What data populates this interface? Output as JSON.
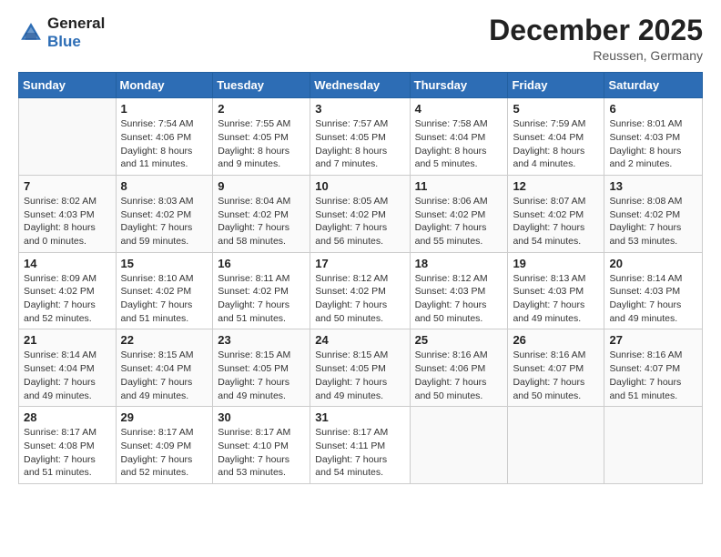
{
  "header": {
    "logo_line1": "General",
    "logo_line2": "Blue",
    "month": "December 2025",
    "location": "Reussen, Germany"
  },
  "weekdays": [
    "Sunday",
    "Monday",
    "Tuesday",
    "Wednesday",
    "Thursday",
    "Friday",
    "Saturday"
  ],
  "weeks": [
    [
      {
        "day": "",
        "sunrise": "",
        "sunset": "",
        "daylight": ""
      },
      {
        "day": "1",
        "sunrise": "Sunrise: 7:54 AM",
        "sunset": "Sunset: 4:06 PM",
        "daylight": "Daylight: 8 hours and 11 minutes."
      },
      {
        "day": "2",
        "sunrise": "Sunrise: 7:55 AM",
        "sunset": "Sunset: 4:05 PM",
        "daylight": "Daylight: 8 hours and 9 minutes."
      },
      {
        "day": "3",
        "sunrise": "Sunrise: 7:57 AM",
        "sunset": "Sunset: 4:05 PM",
        "daylight": "Daylight: 8 hours and 7 minutes."
      },
      {
        "day": "4",
        "sunrise": "Sunrise: 7:58 AM",
        "sunset": "Sunset: 4:04 PM",
        "daylight": "Daylight: 8 hours and 5 minutes."
      },
      {
        "day": "5",
        "sunrise": "Sunrise: 7:59 AM",
        "sunset": "Sunset: 4:04 PM",
        "daylight": "Daylight: 8 hours and 4 minutes."
      },
      {
        "day": "6",
        "sunrise": "Sunrise: 8:01 AM",
        "sunset": "Sunset: 4:03 PM",
        "daylight": "Daylight: 8 hours and 2 minutes."
      }
    ],
    [
      {
        "day": "7",
        "sunrise": "Sunrise: 8:02 AM",
        "sunset": "Sunset: 4:03 PM",
        "daylight": "Daylight: 8 hours and 0 minutes."
      },
      {
        "day": "8",
        "sunrise": "Sunrise: 8:03 AM",
        "sunset": "Sunset: 4:02 PM",
        "daylight": "Daylight: 7 hours and 59 minutes."
      },
      {
        "day": "9",
        "sunrise": "Sunrise: 8:04 AM",
        "sunset": "Sunset: 4:02 PM",
        "daylight": "Daylight: 7 hours and 58 minutes."
      },
      {
        "day": "10",
        "sunrise": "Sunrise: 8:05 AM",
        "sunset": "Sunset: 4:02 PM",
        "daylight": "Daylight: 7 hours and 56 minutes."
      },
      {
        "day": "11",
        "sunrise": "Sunrise: 8:06 AM",
        "sunset": "Sunset: 4:02 PM",
        "daylight": "Daylight: 7 hours and 55 minutes."
      },
      {
        "day": "12",
        "sunrise": "Sunrise: 8:07 AM",
        "sunset": "Sunset: 4:02 PM",
        "daylight": "Daylight: 7 hours and 54 minutes."
      },
      {
        "day": "13",
        "sunrise": "Sunrise: 8:08 AM",
        "sunset": "Sunset: 4:02 PM",
        "daylight": "Daylight: 7 hours and 53 minutes."
      }
    ],
    [
      {
        "day": "14",
        "sunrise": "Sunrise: 8:09 AM",
        "sunset": "Sunset: 4:02 PM",
        "daylight": "Daylight: 7 hours and 52 minutes."
      },
      {
        "day": "15",
        "sunrise": "Sunrise: 8:10 AM",
        "sunset": "Sunset: 4:02 PM",
        "daylight": "Daylight: 7 hours and 51 minutes."
      },
      {
        "day": "16",
        "sunrise": "Sunrise: 8:11 AM",
        "sunset": "Sunset: 4:02 PM",
        "daylight": "Daylight: 7 hours and 51 minutes."
      },
      {
        "day": "17",
        "sunrise": "Sunrise: 8:12 AM",
        "sunset": "Sunset: 4:02 PM",
        "daylight": "Daylight: 7 hours and 50 minutes."
      },
      {
        "day": "18",
        "sunrise": "Sunrise: 8:12 AM",
        "sunset": "Sunset: 4:03 PM",
        "daylight": "Daylight: 7 hours and 50 minutes."
      },
      {
        "day": "19",
        "sunrise": "Sunrise: 8:13 AM",
        "sunset": "Sunset: 4:03 PM",
        "daylight": "Daylight: 7 hours and 49 minutes."
      },
      {
        "day": "20",
        "sunrise": "Sunrise: 8:14 AM",
        "sunset": "Sunset: 4:03 PM",
        "daylight": "Daylight: 7 hours and 49 minutes."
      }
    ],
    [
      {
        "day": "21",
        "sunrise": "Sunrise: 8:14 AM",
        "sunset": "Sunset: 4:04 PM",
        "daylight": "Daylight: 7 hours and 49 minutes."
      },
      {
        "day": "22",
        "sunrise": "Sunrise: 8:15 AM",
        "sunset": "Sunset: 4:04 PM",
        "daylight": "Daylight: 7 hours and 49 minutes."
      },
      {
        "day": "23",
        "sunrise": "Sunrise: 8:15 AM",
        "sunset": "Sunset: 4:05 PM",
        "daylight": "Daylight: 7 hours and 49 minutes."
      },
      {
        "day": "24",
        "sunrise": "Sunrise: 8:15 AM",
        "sunset": "Sunset: 4:05 PM",
        "daylight": "Daylight: 7 hours and 49 minutes."
      },
      {
        "day": "25",
        "sunrise": "Sunrise: 8:16 AM",
        "sunset": "Sunset: 4:06 PM",
        "daylight": "Daylight: 7 hours and 50 minutes."
      },
      {
        "day": "26",
        "sunrise": "Sunrise: 8:16 AM",
        "sunset": "Sunset: 4:07 PM",
        "daylight": "Daylight: 7 hours and 50 minutes."
      },
      {
        "day": "27",
        "sunrise": "Sunrise: 8:16 AM",
        "sunset": "Sunset: 4:07 PM",
        "daylight": "Daylight: 7 hours and 51 minutes."
      }
    ],
    [
      {
        "day": "28",
        "sunrise": "Sunrise: 8:17 AM",
        "sunset": "Sunset: 4:08 PM",
        "daylight": "Daylight: 7 hours and 51 minutes."
      },
      {
        "day": "29",
        "sunrise": "Sunrise: 8:17 AM",
        "sunset": "Sunset: 4:09 PM",
        "daylight": "Daylight: 7 hours and 52 minutes."
      },
      {
        "day": "30",
        "sunrise": "Sunrise: 8:17 AM",
        "sunset": "Sunset: 4:10 PM",
        "daylight": "Daylight: 7 hours and 53 minutes."
      },
      {
        "day": "31",
        "sunrise": "Sunrise: 8:17 AM",
        "sunset": "Sunset: 4:11 PM",
        "daylight": "Daylight: 7 hours and 54 minutes."
      },
      {
        "day": "",
        "sunrise": "",
        "sunset": "",
        "daylight": ""
      },
      {
        "day": "",
        "sunrise": "",
        "sunset": "",
        "daylight": ""
      },
      {
        "day": "",
        "sunrise": "",
        "sunset": "",
        "daylight": ""
      }
    ]
  ]
}
